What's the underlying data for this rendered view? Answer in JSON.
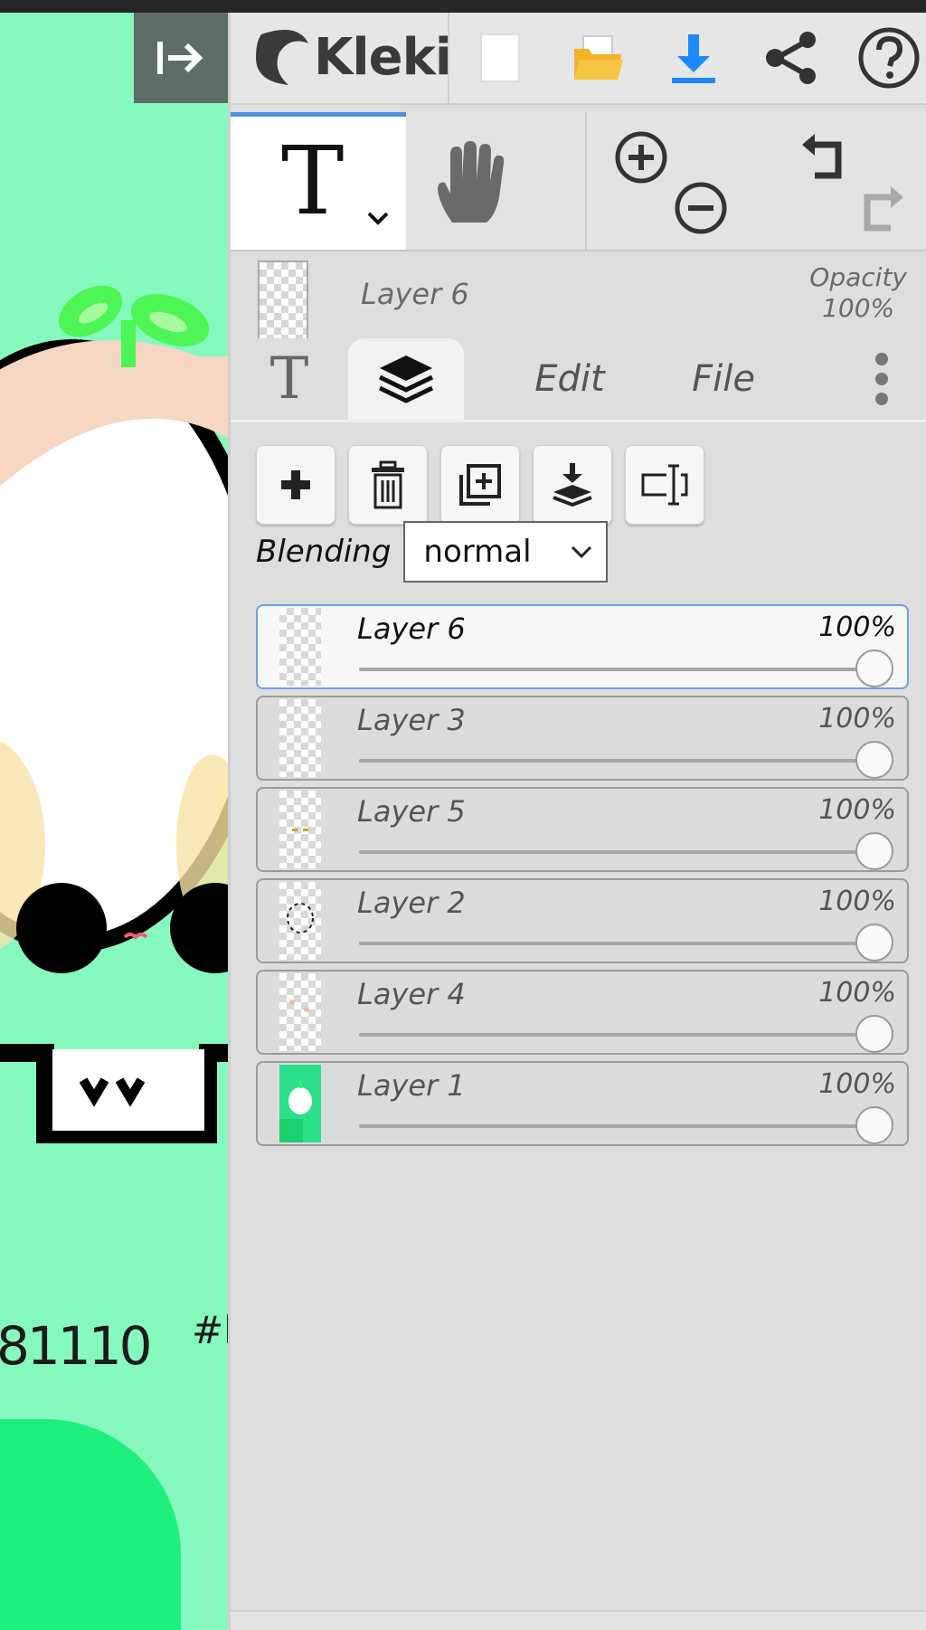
{
  "app": {
    "brand": "Kleki"
  },
  "header": {
    "buttons": [
      "new-image",
      "open-file",
      "download",
      "share",
      "help"
    ],
    "colors": {
      "download": "#1e88ff",
      "folder": "#f3b327"
    }
  },
  "tools": {
    "active_tool_glyph": "T",
    "tool_names": [
      "text",
      "hand",
      "zoom-in",
      "zoom-out",
      "undo",
      "redo"
    ]
  },
  "layer_info": {
    "current_layer": "Layer 6",
    "opacity_label": "Opacity",
    "opacity_value": "100%"
  },
  "tabs": {
    "tools_glyph": "T",
    "edit": "Edit",
    "file": "File"
  },
  "blending": {
    "label": "Blending",
    "value": "normal"
  },
  "layers": [
    {
      "name": "Layer 6",
      "opacity": "100%",
      "active": true
    },
    {
      "name": "Layer 3",
      "opacity": "100%",
      "active": false
    },
    {
      "name": "Layer 5",
      "opacity": "100%",
      "active": false
    },
    {
      "name": "Layer 2",
      "opacity": "100%",
      "active": false
    },
    {
      "name": "Layer 4",
      "opacity": "100%",
      "active": false
    },
    {
      "name": "Layer 1",
      "opacity": "100%",
      "active": false
    }
  ],
  "canvas": {
    "partial_text_1": "81110",
    "partial_text_2": "#k"
  }
}
